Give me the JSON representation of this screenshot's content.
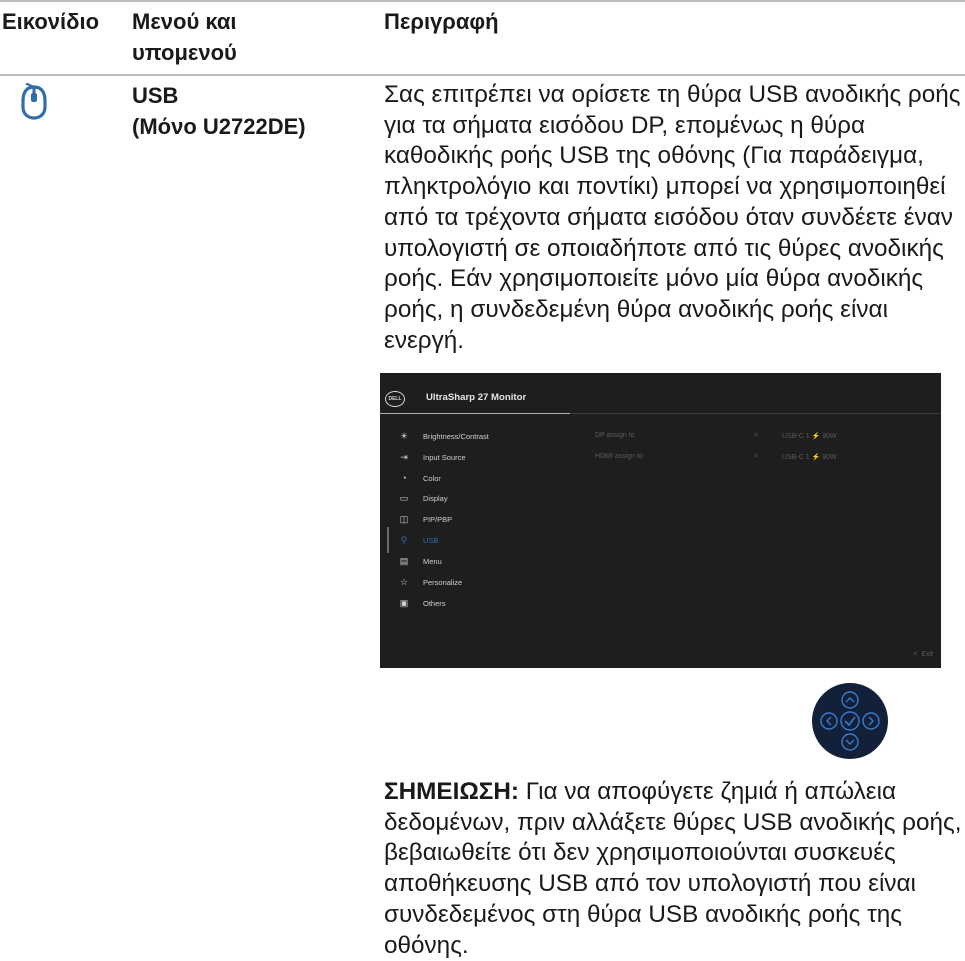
{
  "table_header": {
    "icon_col": "Εικονίδιο",
    "menu_col": "Μενού και υπομενού",
    "desc_col": "Περιγραφή"
  },
  "row": {
    "icon": "usb-mouse-icon",
    "menu_title_line1": "USB",
    "menu_title_line2": "(Μόνο U2722DE)",
    "description": "Σας επιτρέπει να ορίσετε τη θύρα USB ανοδικής ροής για τα σήματα εισόδου DP, επομένως η θύρα καθοδικής ροής USB της οθόνης (Για παράδειγμα, πληκτρολόγιο και ποντίκι) μπορεί να χρησιμοποιηθεί από τα τρέχοντα σήματα εισόδου όταν συνδέετε έναν υπολογιστή σε οποιαδήποτε από τις θύρες ανοδικής ροής. Εάν χρησιμοποιείτε μόνο μία θύρα ανοδικής ροής, η συνδεδεμένη θύρα ανοδικής ροής είναι ενεργή.",
    "note_label": "ΣΗΜΕΙΩΣΗ:",
    "note_text": " Για να αποφύγετε ζημιά ή απώλεια δεδομένων, πριν αλλάξετε θύρες USB ανοδικής ροής, βεβαιωθείτε ότι δεν χρησιμοποιούνται συσκευές αποθήκευσης USB από τον υπολογιστή που είναι συνδεδεμένος στη θύρα USB ανοδικής ροής της οθόνης."
  },
  "osd": {
    "logo_text": "DELL",
    "title": "UltraSharp 27 Monitor",
    "menu_items": [
      {
        "label": "Brightness/Contrast",
        "icon": "sun-icon",
        "active": false
      },
      {
        "label": "Input Source",
        "icon": "input-source-icon",
        "active": false
      },
      {
        "label": "Color",
        "icon": "palette-icon",
        "active": false
      },
      {
        "label": "Display",
        "icon": "display-icon",
        "active": false
      },
      {
        "label": "PIP/PBP",
        "icon": "pip-icon",
        "active": false
      },
      {
        "label": "USB",
        "icon": "usb-icon",
        "active": true
      },
      {
        "label": "Menu",
        "icon": "menu-icon",
        "active": false
      },
      {
        "label": "Personalize",
        "icon": "star-icon",
        "active": false
      },
      {
        "label": "Others",
        "icon": "others-icon",
        "active": false
      }
    ],
    "settings": [
      {
        "label": "DP assign to",
        "arrow": ">",
        "value": "USB-C 1 ⚡ 90W"
      },
      {
        "label": "HDMI assign to",
        "arrow": ">",
        "value": "USB-C 1 ⚡ 90W"
      }
    ],
    "exit_label": "Exit",
    "colors": {
      "background": "#1e1e1e",
      "active": "#2f6ea8",
      "text": "#cfcfcf",
      "dim": "#5a5a5a"
    }
  },
  "joystick": {
    "icon": "joystick-icon",
    "buttons": [
      "up",
      "left",
      "ok",
      "right",
      "down"
    ],
    "accent": "#2f6ea8"
  }
}
